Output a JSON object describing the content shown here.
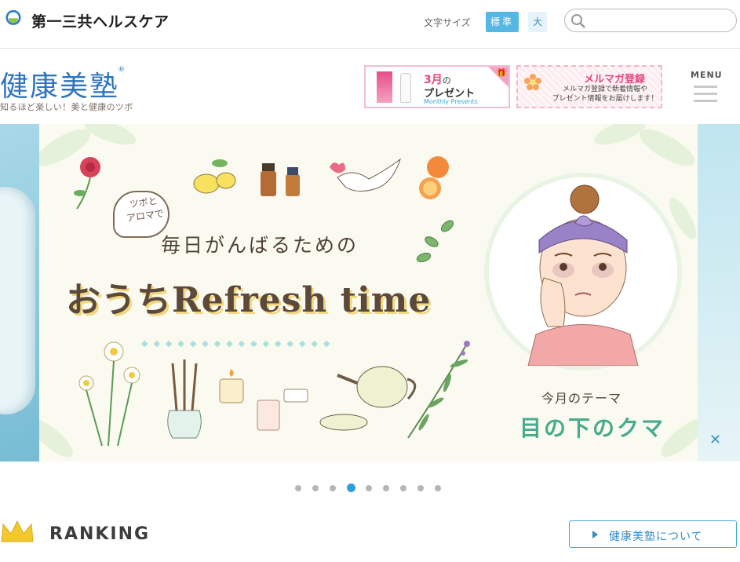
{
  "header": {
    "company_name": "第一三共ヘルスケア",
    "logo_text": "Daiichi-Sankyo",
    "font_size_label": "文字サイズ",
    "font_size_standard": "標準",
    "font_size_large": "大",
    "search_placeholder": ""
  },
  "brand": {
    "title": "健康美塾",
    "registered_mark": "®",
    "tagline": "知るほど楽しい！美と健康のツボ"
  },
  "promo_banners": [
    {
      "month": "3月",
      "month_suffix": "の",
      "title": "プレゼント",
      "subtitle_en": "Monthly Presents"
    },
    {
      "title": "メルマガ登録",
      "description": "メルマガ登録で新着情報や\nプレゼント情報をお届けします！"
    }
  ],
  "menu": {
    "label": "MENU"
  },
  "hero": {
    "bubble_text": "ツボと\nアロマで",
    "subtitle": "毎日がんばるための",
    "main_title": "おうちRefresh time",
    "diamonds": "◆◆◆◆◆◆◆◆◆◆◆◆◆◆◆◆",
    "theme_label": "今月のテーマ",
    "theme_title": "目の下のクマ",
    "close_label": "✕"
  },
  "carousel": {
    "total": 9,
    "active_index": 3
  },
  "ranking": {
    "title": "RANKING"
  },
  "about_button": {
    "label": "健康美塾について"
  },
  "colors": {
    "brand_blue": "#2f74bf",
    "accent_blue": "#2e9fdc",
    "pink": "#e9457f",
    "theme_green": "#47ab8d"
  }
}
